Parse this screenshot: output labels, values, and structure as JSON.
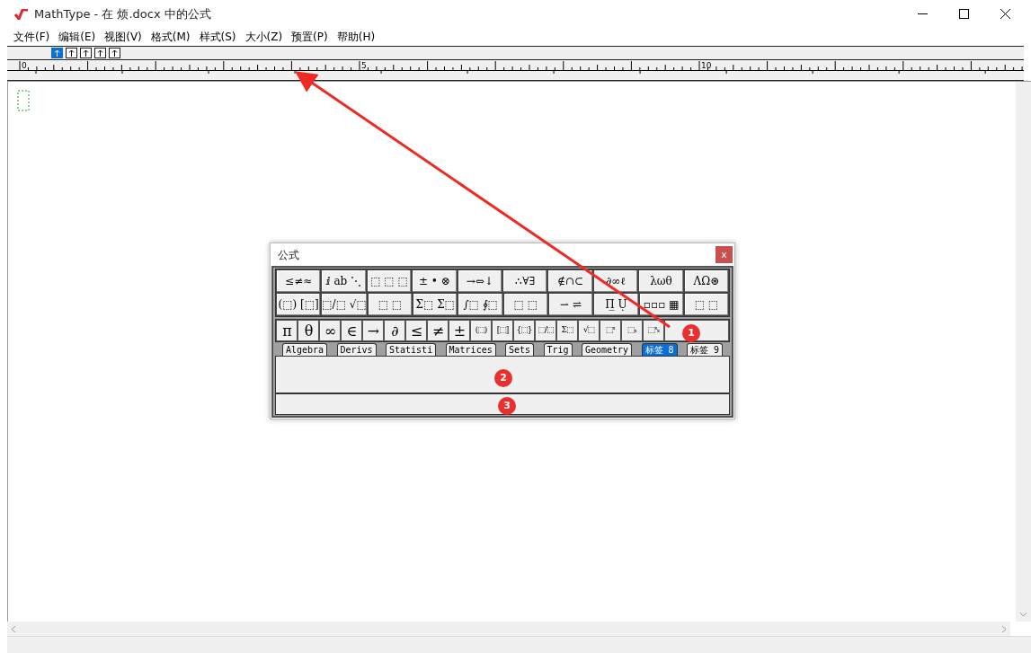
{
  "window": {
    "title": "MathType - 在 烦.docx 中的公式"
  },
  "menu": [
    "文件(F)",
    "编辑(E)",
    "视图(V)",
    "格式(M)",
    "样式(S)",
    "大小(Z)",
    "预置(P)",
    "帮助(H)"
  ],
  "format_buttons": [
    {
      "selected": true
    },
    {
      "selected": false
    },
    {
      "selected": false
    },
    {
      "selected": false
    },
    {
      "selected": false
    }
  ],
  "ruler": {
    "labels": [
      "0",
      "5",
      "10"
    ]
  },
  "palette": {
    "title": "公式",
    "close": "x",
    "symbol_rows": [
      [
        "≤≠≈",
        "ⅈ ab ⋱",
        "⬚ ⬚ ⬚",
        "± • ⊗",
        "→⇔↓",
        "∴∀∃",
        "∉∩⊂",
        "∂∞ℓ",
        "λωθ",
        "ΛΩ⊛"
      ],
      [
        "(⬚) [⬚]",
        "⬚/⬚ √⬚",
        "⬚ ⬚",
        "Σ⬚ Σ⬚",
        "∫⬚ ∮⬚",
        "⬚ ⬚",
        "⇀ ⇌",
        "Π̲ Ụ",
        "▫▫▫ ▦",
        "⬚ ⬚"
      ]
    ],
    "small_bar": [
      "π",
      "θ",
      "∞",
      "∈",
      "→",
      "∂",
      "≤",
      "≠",
      "±",
      "(⬚)",
      "[⬚]",
      "{⬚}",
      "⬚/⬚",
      "Σ⬚",
      "√⬚",
      "⬚ˣ",
      "⬚ₓ",
      "⬚ˣₓ"
    ],
    "tabs": [
      {
        "label": "Algebra",
        "selected": false
      },
      {
        "label": "Derivs",
        "selected": false
      },
      {
        "label": "Statisti",
        "selected": false
      },
      {
        "label": "Matrices",
        "selected": false
      },
      {
        "label": "Sets",
        "selected": false
      },
      {
        "label": "Trig",
        "selected": false
      },
      {
        "label": "Geometry",
        "selected": false
      },
      {
        "label": "标签 8",
        "selected": true
      },
      {
        "label": "标签 9",
        "selected": false
      }
    ]
  },
  "annotations": [
    {
      "label": "1"
    },
    {
      "label": "2"
    },
    {
      "label": "3"
    }
  ]
}
